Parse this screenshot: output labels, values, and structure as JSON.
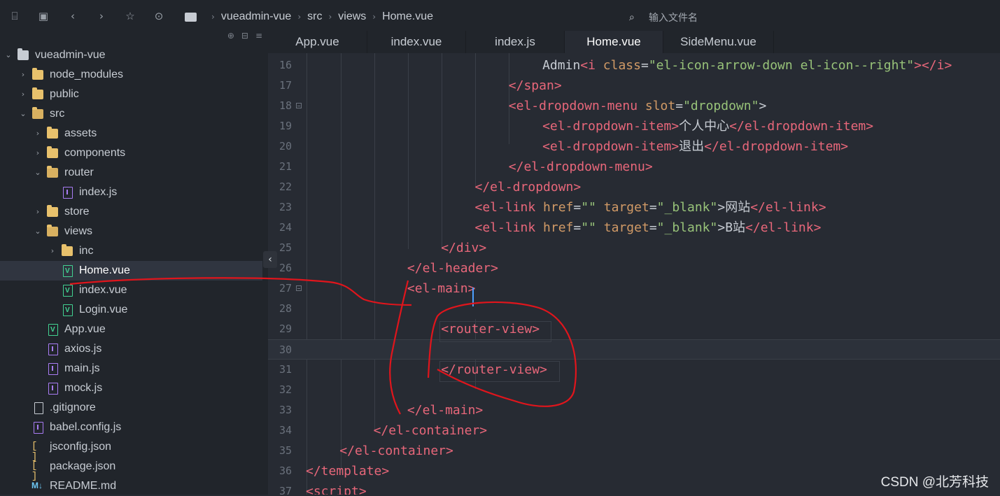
{
  "toolbar": {
    "icons": [
      "outline-icon",
      "save-icon",
      "back-icon",
      "forward-icon",
      "star-icon",
      "run-icon"
    ]
  },
  "breadcrumb": {
    "items": [
      "vueadmin-vue",
      "src",
      "views",
      "Home.vue"
    ]
  },
  "file_search": {
    "placeholder": "输入文件名"
  },
  "tree": {
    "items": [
      {
        "label": "vueadmin-vue"
      },
      {
        "label": "node_modules"
      },
      {
        "label": "public"
      },
      {
        "label": "src"
      },
      {
        "label": "assets"
      },
      {
        "label": "components"
      },
      {
        "label": "router"
      },
      {
        "label": "index.js"
      },
      {
        "label": "store"
      },
      {
        "label": "views"
      },
      {
        "label": "inc"
      },
      {
        "label": "Home.vue"
      },
      {
        "label": "index.vue"
      },
      {
        "label": "Login.vue"
      },
      {
        "label": "App.vue"
      },
      {
        "label": "axios.js"
      },
      {
        "label": "main.js"
      },
      {
        "label": "mock.js"
      },
      {
        "label": ".gitignore"
      },
      {
        "label": "babel.config.js"
      },
      {
        "label": "jsconfig.json"
      },
      {
        "label": "package.json"
      },
      {
        "label": "README.md"
      }
    ]
  },
  "tabs": [
    "App.vue",
    "index.vue",
    "index.js",
    "Home.vue",
    "SideMenu.vue"
  ],
  "editor": {
    "active_line": "30",
    "lines": [
      {
        "n": "16",
        "parts": [
          "Admin",
          "<i ",
          "class",
          "=",
          "\"el-icon-arrow-down el-icon--right\"",
          "></i>"
        ]
      },
      {
        "n": "17",
        "parts": [
          "</span>"
        ]
      },
      {
        "n": "18",
        "parts": [
          "<el-dropdown-menu ",
          "slot",
          "=",
          "\"dropdown\"",
          ">"
        ]
      },
      {
        "n": "19",
        "parts": [
          "<el-dropdown-item>",
          "个人中心",
          "</el-dropdown-item>"
        ]
      },
      {
        "n": "20",
        "parts": [
          "<el-dropdown-item>",
          "退出",
          "</el-dropdown-item>"
        ]
      },
      {
        "n": "21",
        "parts": [
          "</el-dropdown-menu>"
        ]
      },
      {
        "n": "22",
        "parts": [
          "</el-dropdown>"
        ]
      },
      {
        "n": "23",
        "parts": [
          "<el-link ",
          "href",
          "=",
          "\"\"",
          " ",
          "target",
          "=",
          "\"_blank\"",
          ">",
          "网站",
          "</el-link>"
        ]
      },
      {
        "n": "24",
        "parts": [
          "<el-link ",
          "href",
          "=",
          "\"\"",
          " ",
          "target",
          "=",
          "\"_blank\"",
          ">",
          "B站",
          "</el-link>"
        ]
      },
      {
        "n": "25",
        "parts": [
          "</div>"
        ]
      },
      {
        "n": "26",
        "parts": [
          "</el-header>"
        ]
      },
      {
        "n": "27",
        "parts": [
          "<el-main>"
        ]
      },
      {
        "n": "28",
        "parts": [
          ""
        ]
      },
      {
        "n": "29",
        "parts": [
          "<router-view>"
        ]
      },
      {
        "n": "30",
        "parts": [
          ""
        ]
      },
      {
        "n": "31",
        "parts": [
          "</router-view>"
        ]
      },
      {
        "n": "32",
        "parts": [
          ""
        ]
      },
      {
        "n": "33",
        "parts": [
          "</el-main>"
        ]
      },
      {
        "n": "34",
        "parts": [
          "</el-container>"
        ]
      },
      {
        "n": "35",
        "parts": [
          "</el-container>"
        ]
      },
      {
        "n": "36",
        "parts": [
          "</template>"
        ]
      },
      {
        "n": "37",
        "parts": [
          "<script>"
        ]
      }
    ]
  },
  "watermark": "CSDN @北芳科技",
  "colors": {
    "tag": "#e8677a",
    "attribute": "#d19a66",
    "string": "#98c379",
    "text": "#c7ccd3",
    "annotation": "#e0151c",
    "caret": "#4d9fff"
  }
}
